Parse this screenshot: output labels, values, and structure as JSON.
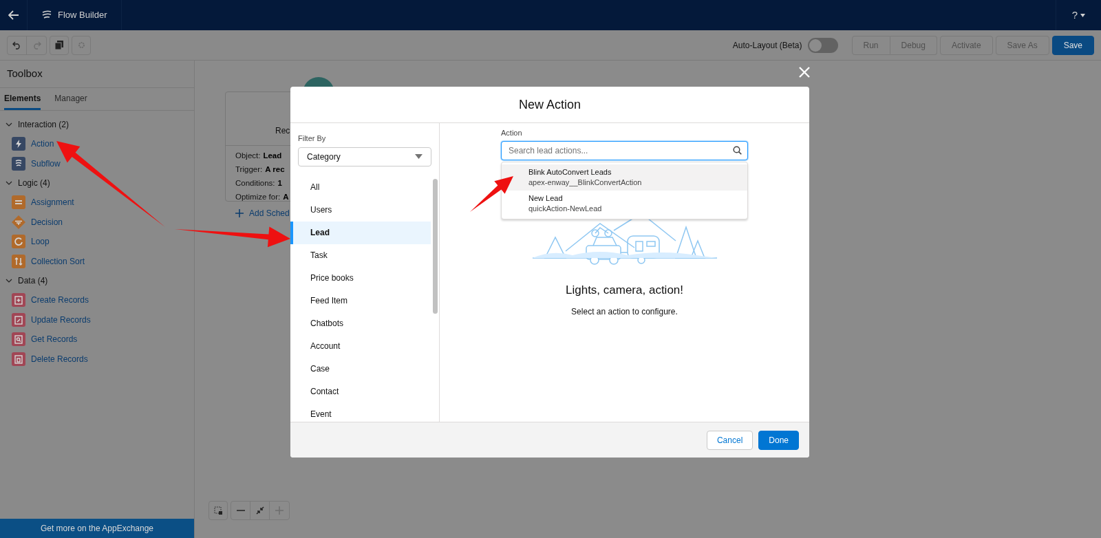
{
  "header": {
    "title": "Flow Builder",
    "help": "?"
  },
  "toolbar": {
    "toggle": {
      "label": "Auto-Layout (Beta)",
      "on": false
    },
    "buttons": [
      {
        "label": "Run",
        "disabled": true,
        "primary": false
      },
      {
        "label": "Debug",
        "disabled": true,
        "primary": false
      },
      {
        "label": "Activate",
        "disabled": true,
        "primary": false
      },
      {
        "label": "Save As",
        "disabled": true,
        "primary": false
      },
      {
        "label": "Save",
        "disabled": false,
        "primary": true
      }
    ]
  },
  "toolbox": {
    "title": "Toolbox",
    "tabs": [
      {
        "label": "Elements",
        "selected": true
      },
      {
        "label": "Manager",
        "selected": false
      }
    ],
    "groups": [
      {
        "label": "Interaction (2)",
        "expanded": true,
        "items": [
          {
            "label": "Action",
            "kind": "bolt",
            "color": "#364763"
          },
          {
            "label": "Subflow",
            "kind": "flow",
            "color": "#364763"
          }
        ]
      },
      {
        "label": "Logic (4)",
        "expanded": true,
        "items": [
          {
            "label": "Assignment",
            "kind": "equals",
            "color": "#b06a2b"
          },
          {
            "label": "Decision",
            "kind": "diamond",
            "color": "#b06a2b"
          },
          {
            "label": "Loop",
            "kind": "loop",
            "color": "#b06a2b"
          },
          {
            "label": "Collection Sort",
            "kind": "sort",
            "color": "#b06a2b"
          }
        ]
      },
      {
        "label": "Data (4)",
        "expanded": true,
        "items": [
          {
            "label": "Create Records",
            "kind": "create",
            "color": "#a14655"
          },
          {
            "label": "Update Records",
            "kind": "update",
            "color": "#a14655"
          },
          {
            "label": "Get Records",
            "kind": "get",
            "color": "#a14655"
          },
          {
            "label": "Delete Records",
            "kind": "delete",
            "color": "#a14655"
          }
        ]
      }
    ],
    "footer_link": "Get more on the AppExchange"
  },
  "canvas": {
    "card": {
      "title": "Rec",
      "fields": [
        {
          "label": "Object:",
          "value": "Lead"
        },
        {
          "label": "Trigger:",
          "value": "A rec"
        },
        {
          "label": "Conditions:",
          "value": "1"
        },
        {
          "label": "Optimize for:",
          "value": "A"
        }
      ],
      "link": "Add Sched"
    }
  },
  "modal": {
    "title": "New Action",
    "filter": {
      "label": "Filter By",
      "value": "Category"
    },
    "categories": [
      {
        "label": "All",
        "selected": false
      },
      {
        "label": "Users",
        "selected": false
      },
      {
        "label": "Lead",
        "selected": true
      },
      {
        "label": "Task",
        "selected": false
      },
      {
        "label": "Price books",
        "selected": false
      },
      {
        "label": "Feed Item",
        "selected": false
      },
      {
        "label": "Chatbots",
        "selected": false
      },
      {
        "label": "Account",
        "selected": false
      },
      {
        "label": "Case",
        "selected": false
      },
      {
        "label": "Contact",
        "selected": false
      },
      {
        "label": "Event",
        "selected": false
      }
    ],
    "action": {
      "label": "Action",
      "placeholder": "Search lead actions...",
      "results": [
        {
          "name": "Blink AutoConvert Leads",
          "id": "apex-enway__BlinkConvertAction",
          "selected": true
        },
        {
          "name": "New Lead",
          "id": "quickAction-NewLead",
          "selected": false
        }
      ]
    },
    "empty": {
      "title": "Lights, camera, action!",
      "text": "Select an action to configure."
    },
    "buttons": [
      {
        "label": "Cancel",
        "kind": "neutral"
      },
      {
        "label": "Done",
        "kind": "brand"
      }
    ]
  }
}
